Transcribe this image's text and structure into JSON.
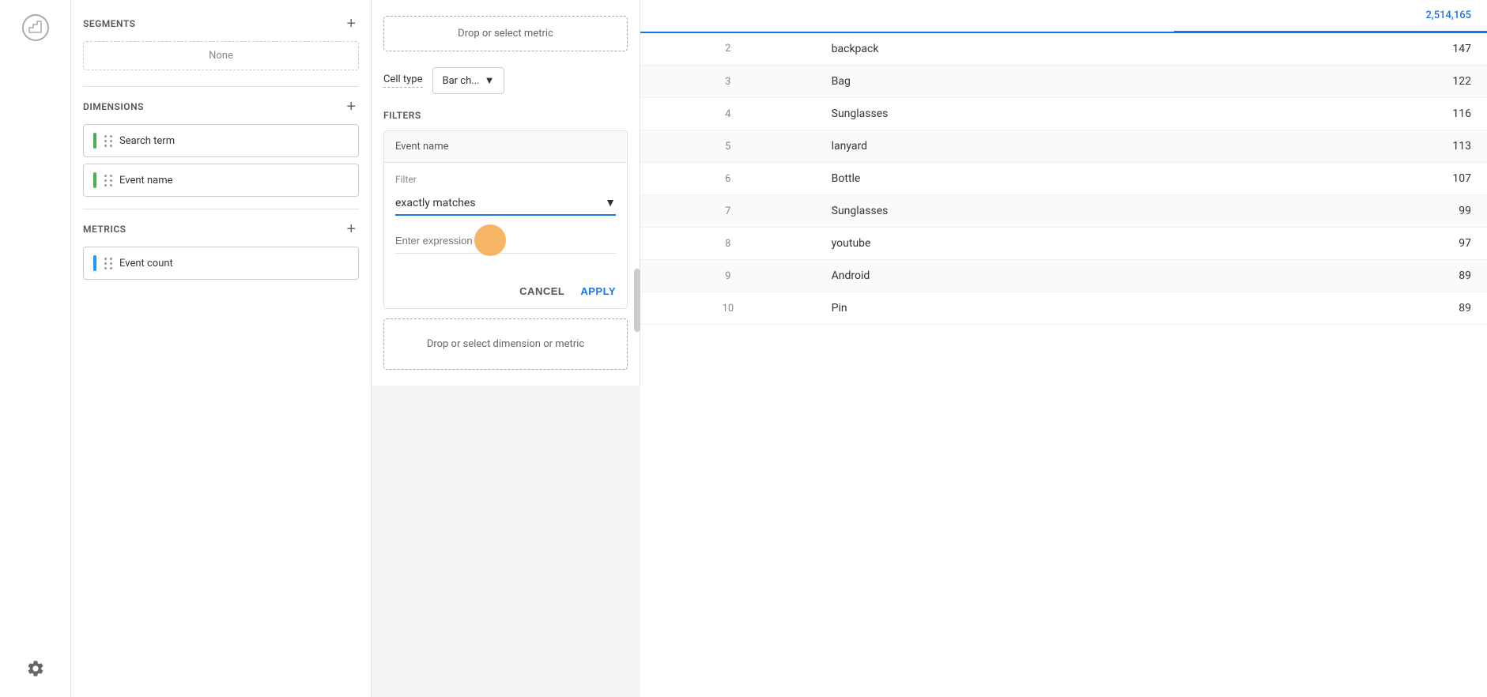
{
  "sidebar": {
    "logo_icon": "analytics-icon",
    "settings_icon": "gear-icon"
  },
  "left_panel": {
    "segments": {
      "title": "SEGMENTS",
      "none_label": "None"
    },
    "dimensions": {
      "title": "DIMENSIONS",
      "items": [
        {
          "label": "Search term",
          "color": "green"
        },
        {
          "label": "Event name",
          "color": "green"
        }
      ]
    },
    "metrics": {
      "title": "METRICS",
      "items": [
        {
          "label": "Event count",
          "color": "blue"
        }
      ]
    }
  },
  "middle_panel": {
    "drop_metric": {
      "label": "Drop or select metric"
    },
    "cell_type": {
      "label": "Cell type",
      "value": "Bar ch...",
      "dropdown_icon": "chevron-down-icon"
    },
    "filters": {
      "title": "FILTERS",
      "filter_field_label": "Event name",
      "filter_label": "Filter",
      "filter_operator": "exactly matches",
      "filter_expression_placeholder": "Enter expression",
      "cancel_label": "CANCEL",
      "apply_label": "APPLY"
    },
    "drop_dimension_metric": {
      "label": "Drop or select dimension or metric"
    }
  },
  "data_table": {
    "columns": [
      "",
      "",
      "2,514,165"
    ],
    "rows": [
      {
        "rank": "2",
        "name": "backpack",
        "value": "147"
      },
      {
        "rank": "3",
        "name": "Bag",
        "value": "122"
      },
      {
        "rank": "4",
        "name": "Sunglasses",
        "value": "116"
      },
      {
        "rank": "5",
        "name": "lanyard",
        "value": "113"
      },
      {
        "rank": "6",
        "name": "Bottle",
        "value": "107"
      },
      {
        "rank": "7",
        "name": "Sunglasses",
        "value": "99"
      },
      {
        "rank": "8",
        "name": "youtube",
        "value": "97"
      },
      {
        "rank": "9",
        "name": "Android",
        "value": "89"
      },
      {
        "rank": "10",
        "name": "Pin",
        "value": "89"
      }
    ]
  }
}
